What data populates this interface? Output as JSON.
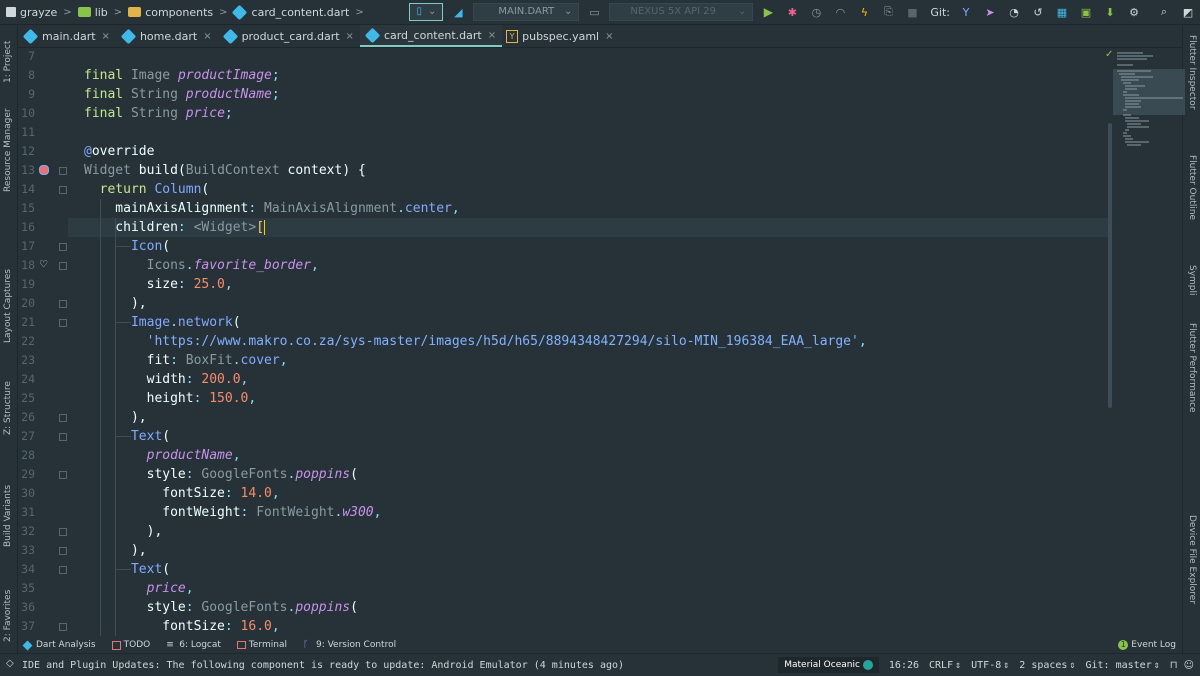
{
  "toolbar": {
    "breadcrumb": [
      "grayze",
      "lib",
      "components",
      "card_content.dart"
    ],
    "run_config": "MAIN.DART",
    "device": "NEXUS 5X API 29",
    "git_label": "Git:"
  },
  "tabs": [
    {
      "label": "main.dart",
      "active": false,
      "icon": "dart-icon"
    },
    {
      "label": "home.dart",
      "active": false,
      "icon": "dart-icon"
    },
    {
      "label": "product_card.dart",
      "active": false,
      "icon": "dart-icon"
    },
    {
      "label": "card_content.dart",
      "active": true,
      "icon": "dart-icon"
    },
    {
      "label": "pubspec.yaml",
      "active": false,
      "icon": "yaml-icon"
    }
  ],
  "left_tools": [
    "1: Project",
    "Resource Manager",
    "Layout Captures",
    "Z: Structure",
    "Build Variants",
    "2: Favorites"
  ],
  "right_tools": [
    "Flutter Inspector",
    "Flutter Outline",
    "Sympli",
    "Flutter Performance",
    "Device File Explorer"
  ],
  "editor": {
    "line_numbers": [
      "7",
      "8",
      "9",
      "10",
      "11",
      "12",
      "13",
      "14",
      "15",
      "16",
      "17",
      "18",
      "19",
      "20",
      "21",
      "22",
      "23",
      "24",
      "25",
      "26",
      "27",
      "28",
      "29",
      "30",
      "31",
      "32",
      "33",
      "34",
      "35",
      "36",
      "37"
    ],
    "current_line": 16,
    "lines": [
      {
        "n": 7,
        "tokens": []
      },
      {
        "n": 8,
        "tokens": [
          {
            "t": "final ",
            "c": "kw"
          },
          {
            "t": "Image ",
            "c": "type"
          },
          {
            "t": "productImage",
            "c": "field"
          },
          {
            "t": ";",
            "c": "punc"
          }
        ]
      },
      {
        "n": 9,
        "tokens": [
          {
            "t": "final ",
            "c": "kw"
          },
          {
            "t": "String ",
            "c": "type"
          },
          {
            "t": "productName",
            "c": "field"
          },
          {
            "t": ";",
            "c": "punc"
          }
        ]
      },
      {
        "n": 10,
        "tokens": [
          {
            "t": "final ",
            "c": "kw"
          },
          {
            "t": "String ",
            "c": "type"
          },
          {
            "t": "price",
            "c": "field"
          },
          {
            "t": ";",
            "c": "punc"
          }
        ]
      },
      {
        "n": 11,
        "tokens": []
      },
      {
        "n": 12,
        "tokens": [
          {
            "t": "@",
            "c": "ann"
          },
          {
            "t": "override",
            "c": "plain"
          }
        ]
      },
      {
        "n": 13,
        "tokens": [
          {
            "t": "Widget ",
            "c": "type"
          },
          {
            "t": "build",
            "c": "plain"
          },
          {
            "t": "(",
            "c": "plain"
          },
          {
            "t": "BuildContext ",
            "c": "type"
          },
          {
            "t": "context",
            "c": "plain"
          },
          {
            "t": ") {",
            "c": "plain"
          }
        ]
      },
      {
        "n": 14,
        "tokens": [
          {
            "t": "  return ",
            "c": "kw"
          },
          {
            "t": "Column",
            "c": "cls"
          },
          {
            "t": "(",
            "c": "plain"
          }
        ]
      },
      {
        "n": 15,
        "tokens": [
          {
            "t": "    mainAxisAlignment",
            "c": "plain"
          },
          {
            "t": ": ",
            "c": "punc"
          },
          {
            "t": "MainAxisAlignment",
            "c": "type"
          },
          {
            "t": ".",
            "c": "punc"
          },
          {
            "t": "center",
            "c": "ann"
          },
          {
            "t": ",",
            "c": "comma"
          }
        ]
      },
      {
        "n": 16,
        "tokens": [
          {
            "t": "    children",
            "c": "plain"
          },
          {
            "t": ": ",
            "c": "punc"
          },
          {
            "t": "<Widget>",
            "c": "type"
          },
          {
            "t": "[",
            "c": "bracket"
          }
        ]
      },
      {
        "n": 17,
        "tokens": [
          {
            "t": "      Icon",
            "c": "cls"
          },
          {
            "t": "(",
            "c": "plain"
          }
        ]
      },
      {
        "n": 18,
        "tokens": [
          {
            "t": "        Icons",
            "c": "type"
          },
          {
            "t": ".",
            "c": "punc"
          },
          {
            "t": "favorite_border",
            "c": "const"
          },
          {
            "t": ",",
            "c": "comma"
          }
        ]
      },
      {
        "n": 19,
        "tokens": [
          {
            "t": "        size",
            "c": "param"
          },
          {
            "t": ": ",
            "c": "punc"
          },
          {
            "t": "25.0",
            "c": "num"
          },
          {
            "t": ",",
            "c": "comma"
          }
        ]
      },
      {
        "n": 20,
        "tokens": [
          {
            "t": "      ),",
            "c": "plain"
          }
        ]
      },
      {
        "n": 21,
        "tokens": [
          {
            "t": "      Image",
            "c": "cls"
          },
          {
            "t": ".",
            "c": "punc"
          },
          {
            "t": "network",
            "c": "cls"
          },
          {
            "t": "(",
            "c": "plain"
          }
        ]
      },
      {
        "n": 22,
        "tokens": [
          {
            "t": "        'https://www.makro.co.za/sys-master/images/h5d/h65/8894348427294/silo-MIN_196384_EAA_large'",
            "c": "str"
          },
          {
            "t": ",",
            "c": "comma"
          }
        ]
      },
      {
        "n": 23,
        "tokens": [
          {
            "t": "        fit",
            "c": "param"
          },
          {
            "t": ": ",
            "c": "punc"
          },
          {
            "t": "BoxFit",
            "c": "type"
          },
          {
            "t": ".",
            "c": "punc"
          },
          {
            "t": "cover",
            "c": "ann"
          },
          {
            "t": ",",
            "c": "comma"
          }
        ]
      },
      {
        "n": 24,
        "tokens": [
          {
            "t": "        width",
            "c": "param"
          },
          {
            "t": ": ",
            "c": "punc"
          },
          {
            "t": "200.0",
            "c": "num"
          },
          {
            "t": ",",
            "c": "comma"
          }
        ]
      },
      {
        "n": 25,
        "tokens": [
          {
            "t": "        height",
            "c": "param"
          },
          {
            "t": ": ",
            "c": "punc"
          },
          {
            "t": "150.0",
            "c": "num"
          },
          {
            "t": ",",
            "c": "comma"
          }
        ]
      },
      {
        "n": 26,
        "tokens": [
          {
            "t": "      ),",
            "c": "plain"
          }
        ]
      },
      {
        "n": 27,
        "tokens": [
          {
            "t": "      Text",
            "c": "cls"
          },
          {
            "t": "(",
            "c": "plain"
          }
        ]
      },
      {
        "n": 28,
        "tokens": [
          {
            "t": "        productName",
            "c": "field"
          },
          {
            "t": ",",
            "c": "comma"
          }
        ]
      },
      {
        "n": 29,
        "tokens": [
          {
            "t": "        style",
            "c": "param"
          },
          {
            "t": ": ",
            "c": "punc"
          },
          {
            "t": "GoogleFonts",
            "c": "type"
          },
          {
            "t": ".",
            "c": "punc"
          },
          {
            "t": "poppins",
            "c": "const"
          },
          {
            "t": "(",
            "c": "plain"
          }
        ]
      },
      {
        "n": 30,
        "tokens": [
          {
            "t": "          fontSize",
            "c": "param"
          },
          {
            "t": ": ",
            "c": "punc"
          },
          {
            "t": "14.0",
            "c": "num"
          },
          {
            "t": ",",
            "c": "comma"
          }
        ]
      },
      {
        "n": 31,
        "tokens": [
          {
            "t": "          fontWeight",
            "c": "param"
          },
          {
            "t": ": ",
            "c": "punc"
          },
          {
            "t": "FontWeight",
            "c": "type"
          },
          {
            "t": ".",
            "c": "punc"
          },
          {
            "t": "w300",
            "c": "const"
          },
          {
            "t": ",",
            "c": "comma"
          }
        ]
      },
      {
        "n": 32,
        "tokens": [
          {
            "t": "        ),",
            "c": "plain"
          }
        ]
      },
      {
        "n": 33,
        "tokens": [
          {
            "t": "      ),",
            "c": "plain"
          }
        ]
      },
      {
        "n": 34,
        "tokens": [
          {
            "t": "      Text",
            "c": "cls"
          },
          {
            "t": "(",
            "c": "plain"
          }
        ]
      },
      {
        "n": 35,
        "tokens": [
          {
            "t": "        price",
            "c": "field"
          },
          {
            "t": ",",
            "c": "comma"
          }
        ]
      },
      {
        "n": 36,
        "tokens": [
          {
            "t": "        style",
            "c": "param"
          },
          {
            "t": ": ",
            "c": "punc"
          },
          {
            "t": "GoogleFonts",
            "c": "type"
          },
          {
            "t": ".",
            "c": "punc"
          },
          {
            "t": "poppins",
            "c": "const"
          },
          {
            "t": "(",
            "c": "plain"
          }
        ]
      },
      {
        "n": 37,
        "tokens": [
          {
            "t": "          fontSize",
            "c": "param"
          },
          {
            "t": ": ",
            "c": "punc"
          },
          {
            "t": "16.0",
            "c": "num"
          },
          {
            "t": ",",
            "c": "comma"
          }
        ]
      }
    ]
  },
  "tool_windows": [
    "Dart Analysis",
    "TODO",
    "6: Logcat",
    "Terminal",
    "9: Version Control"
  ],
  "event_log": {
    "count": "1",
    "label": "Event Log"
  },
  "status": {
    "message": "IDE and Plugin Updates: The following component is ready to update: Android Emulator (4 minutes ago)",
    "theme": "Material Oceanic",
    "position": "16:26",
    "line_sep": "CRLF",
    "encoding": "UTF-8",
    "indent": "2 spaces",
    "branch": "Git: master"
  },
  "colors": {
    "background": "#263238",
    "accent": "#80cbc4",
    "keyword": "#c3e88d",
    "field": "#c792ea",
    "string": "#82b1ff",
    "number": "#f78c6c"
  }
}
